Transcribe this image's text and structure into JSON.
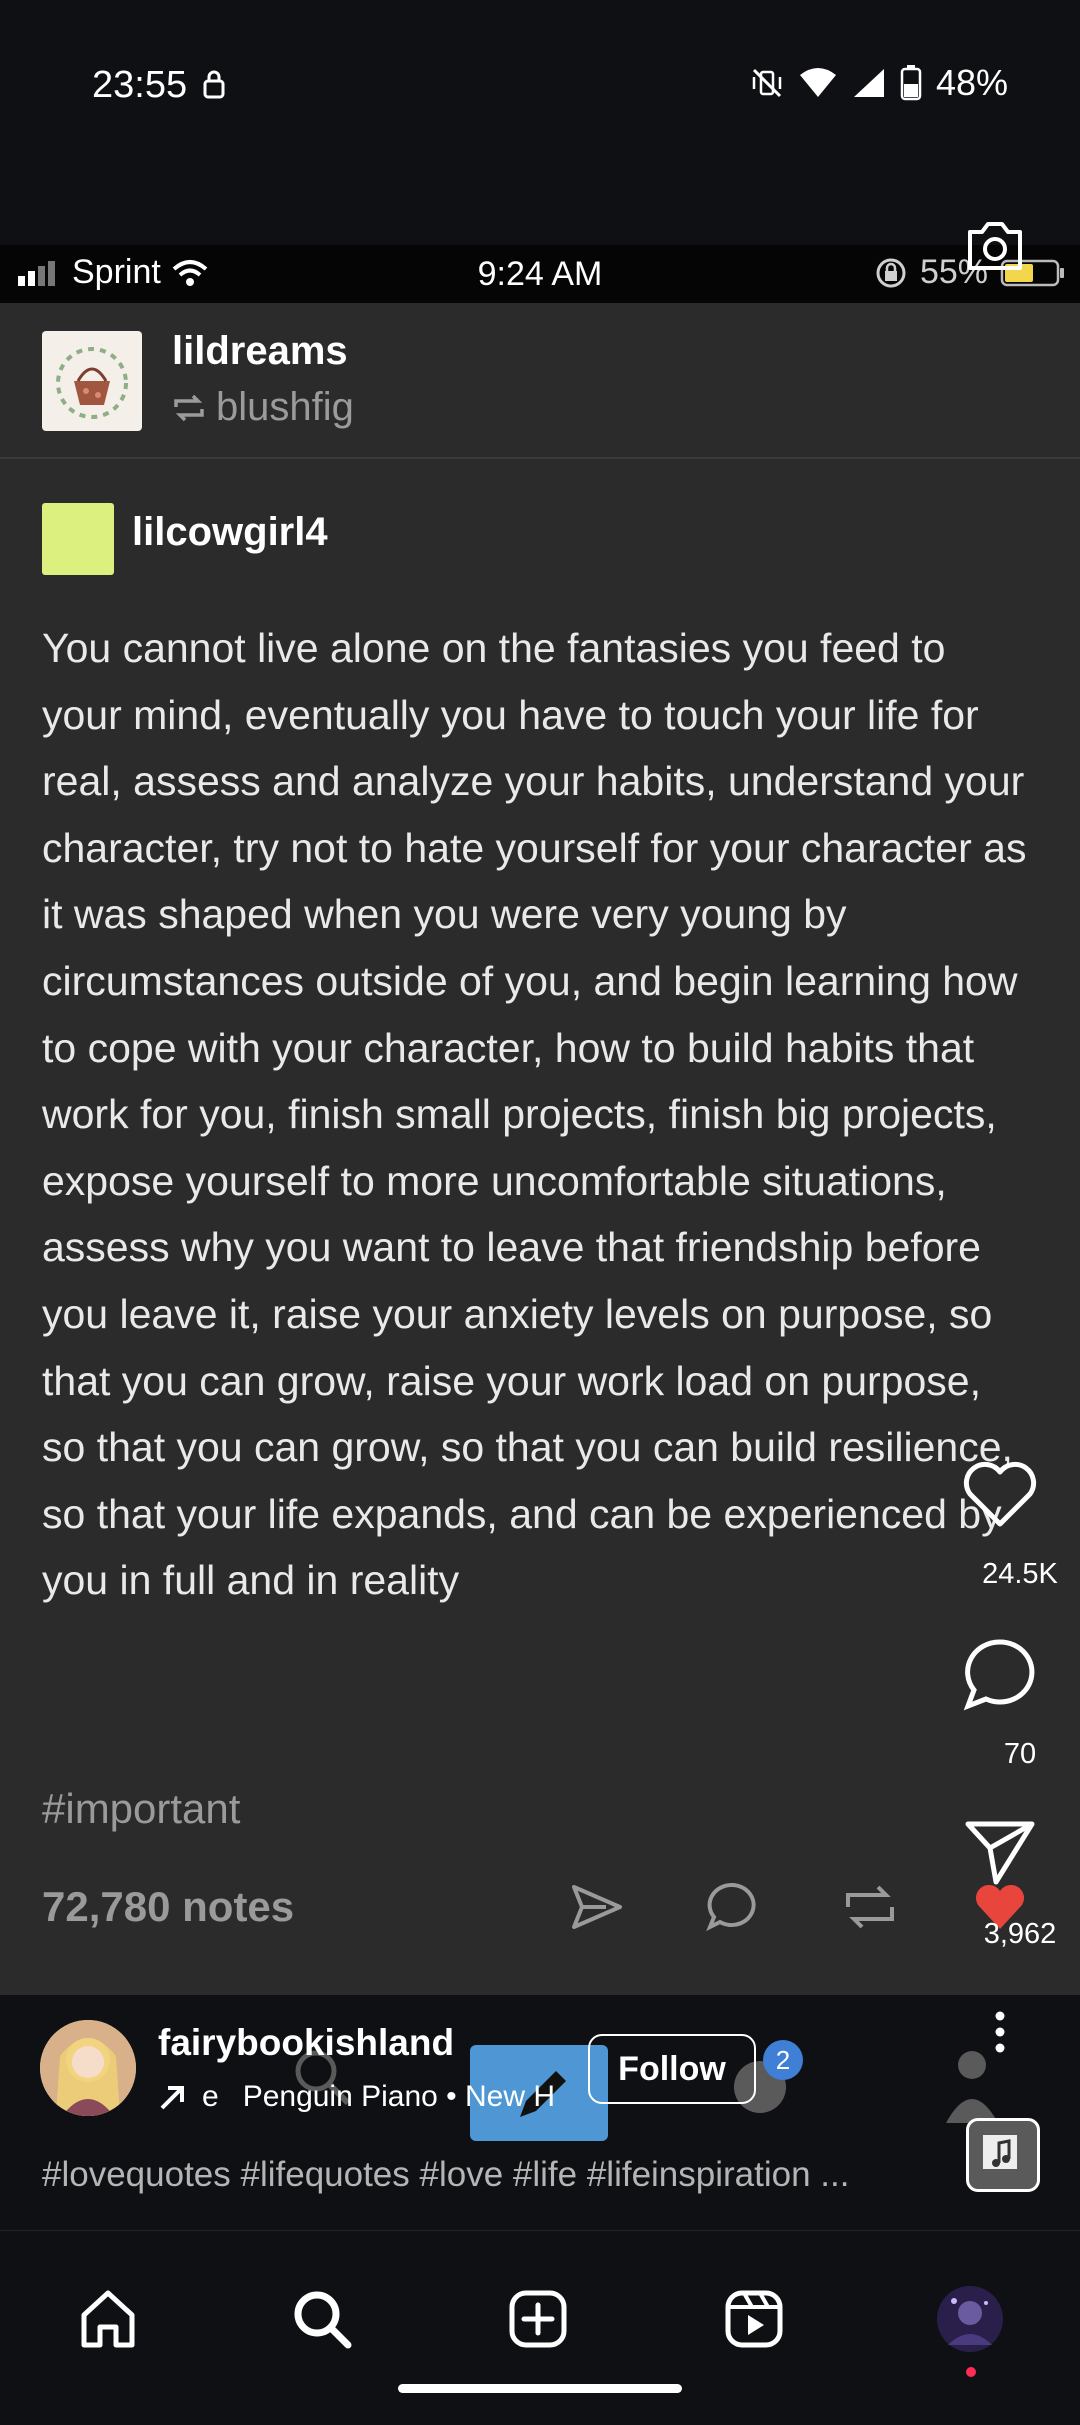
{
  "android_status": {
    "time": "23:55",
    "battery": "48%"
  },
  "ios_status": {
    "carrier": "Sprint",
    "time": "9:24 AM",
    "battery": "55%"
  },
  "post": {
    "reblogger": "lildreams",
    "reblogged_from": "blushfig",
    "author": "lilcowgirl4",
    "body": "You cannot live alone on the fantasies you feed to your mind, eventually you have to touch your life for real, assess and analyze your habits, understand your character, try not to hate yourself for your character as it was shaped when you were very young by circumstances outside of you, and begin learning how to cope with your character, how to build habits that work for you, finish small projects, finish big projects, expose yourself to more uncomfortable situations, assess why you want to leave that friendship before you leave it, raise your anxiety levels on purpose, so that you can grow, raise your work load on purpose, so that you can grow, so that you can build resilience, so that your life expands, and can be experienced by you in full and in reality",
    "tag": "#important",
    "notes": "72,780 notes"
  },
  "reel": {
    "creator": "fairybookishland",
    "audio": "Penguin Piano • New H",
    "audio_prefix": "e",
    "follow_label": "Follow",
    "badge": "2",
    "caption": "#lovequotes #lifequotes #love #life #lifeinspiration ...",
    "likes": "24.5K",
    "comments": "70",
    "shares": "3,962"
  },
  "colors": {
    "like_red": "#e8453c",
    "badge_blue": "#3f7fd6",
    "author_avatar": "#dcf07f"
  }
}
